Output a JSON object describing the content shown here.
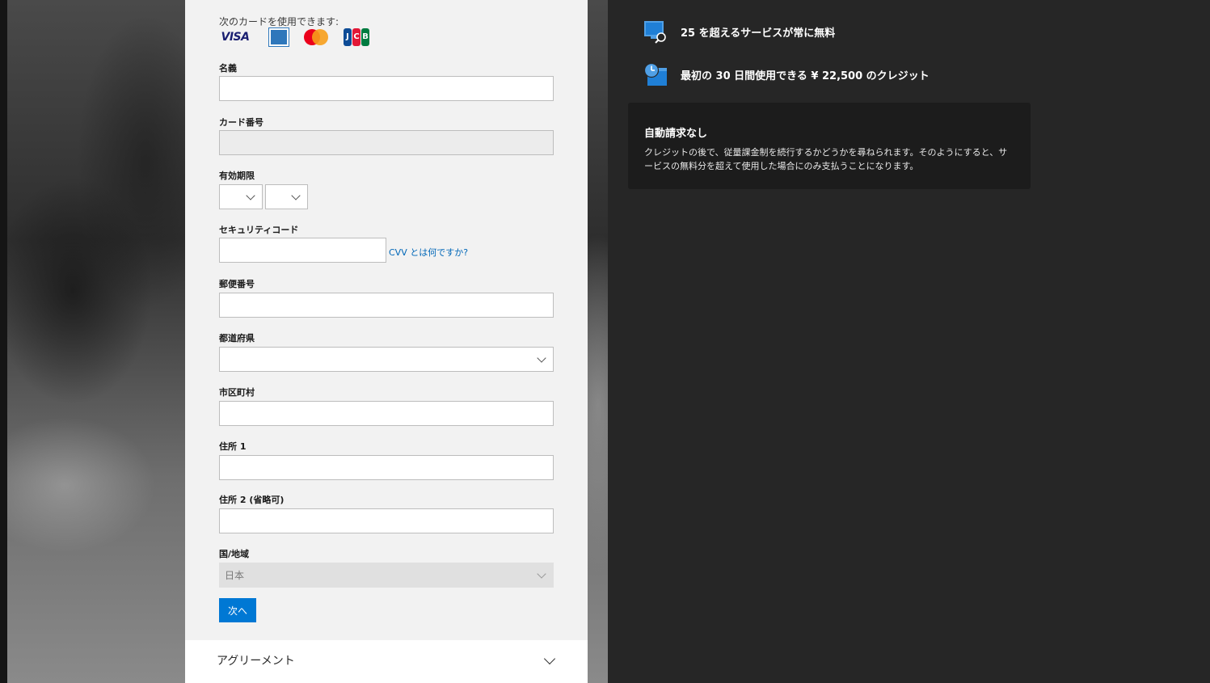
{
  "form": {
    "accepted_cards_label": "次のカードを使用できます:",
    "cards": [
      {
        "name": "visa-icon",
        "label": "VISA"
      },
      {
        "name": "amex-icon",
        "label": ""
      },
      {
        "name": "mastercard-icon",
        "label": ""
      },
      {
        "name": "jcb-icon",
        "label": "JCB"
      }
    ],
    "name_label": "名義",
    "name_value": "",
    "card_number_label": "カード番号",
    "card_number_value": "",
    "expiry_label": "有効期限",
    "expiry_month_value": "",
    "expiry_year_value": "",
    "security_code_label": "セキュリティコード",
    "security_code_value": "",
    "cvv_link": "CVV とは何ですか?",
    "postal_code_label": "郵便番号",
    "postal_code_value": "",
    "prefecture_label": "都道府県",
    "prefecture_value": "",
    "city_label": "市区町村",
    "city_value": "",
    "address1_label": "住所 1",
    "address1_value": "",
    "address2_label": "住所 2 (省略可)",
    "address2_value": "",
    "country_label": "国/地域",
    "country_value": "日本",
    "next_button": "次へ"
  },
  "agreement": {
    "label": "アグリーメント"
  },
  "benefits": [
    {
      "icon": "monitor-search-icon",
      "text": "25 を超えるサービスが常に無料"
    },
    {
      "icon": "clock-calendar-icon",
      "text": "最初の 30 日間使用できる ¥ 22,500 のクレジット"
    }
  ],
  "notice": {
    "title": "自動請求なし",
    "body": "クレジットの後で、従量課金制を続行するかどうかを尋ねられます。そのようにすると、サービスの無料分を超えて使用した場合にのみ支払うことになります。"
  },
  "colors": {
    "accent": "#0078d4",
    "link": "#0067b8",
    "dark_panel": "#262626",
    "notice_card": "#1c1c1c",
    "form_bg": "#f2f2f2"
  }
}
